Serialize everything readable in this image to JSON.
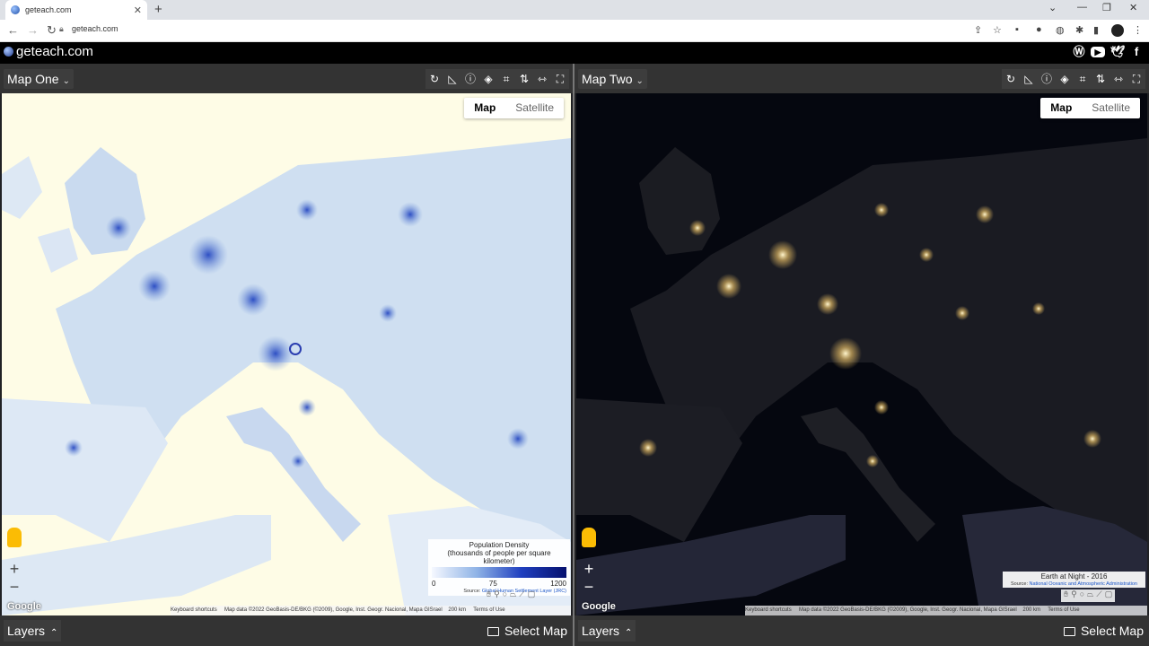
{
  "browser": {
    "tab_title": "geteach.com",
    "url": "geteach.com"
  },
  "site": {
    "brand": "geteach.com"
  },
  "left_panel": {
    "name": "Map One",
    "map_type": [
      "Map",
      "Satellite"
    ],
    "layers_label": "Layers",
    "select_map_label": "Select Map",
    "legend": {
      "title": "Population Density",
      "subtitle": "(thousands of people per square kilometer)",
      "ticks": [
        "0",
        "75",
        "1200"
      ],
      "source_prefix": "Source:",
      "source_link": "Global Human Settlement Layer (JRC)"
    },
    "attribution": {
      "shortcuts": "Keyboard shortcuts",
      "data": "Map data ©2022 GeoBasis-DE/BKG (©2009), Google, Inst. Geogr. Nacional, Mapa GISrael",
      "scale": "200 km",
      "terms": "Terms of Use"
    },
    "google": "Google"
  },
  "right_panel": {
    "name": "Map Two",
    "map_type": [
      "Map",
      "Satellite"
    ],
    "layers_label": "Layers",
    "select_map_label": "Select Map",
    "legend": {
      "title": "Earth at Night - 2016",
      "source_prefix": "Source:",
      "source_link": "National Oceanic and Atmospheric Administration"
    },
    "attribution": {
      "shortcuts": "Keyboard shortcuts",
      "data": "Map data ©2022 GeoBasis-DE/BKG (©2009), Google, Inst. Geogr. Nacional, Mapa GISrael",
      "scale": "200 km",
      "terms": "Terms of Use"
    },
    "google": "Google"
  },
  "icons": {
    "zoom_in": "+",
    "zoom_out": "−"
  }
}
